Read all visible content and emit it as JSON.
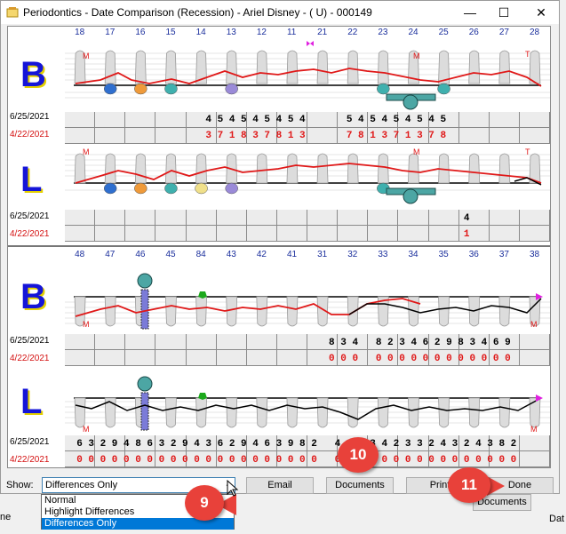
{
  "window": {
    "title": "Periodontics - Date Comparison (Recession) - Ariel Disney - ( U) - 000149",
    "minimize": "—",
    "maximize": "☐",
    "close": "✕"
  },
  "upper": {
    "tooth_numbers": [
      "18",
      "17",
      "16",
      "15",
      "14",
      "13",
      "12",
      "11",
      "21",
      "22",
      "23",
      "24",
      "25",
      "26",
      "27",
      "28"
    ],
    "buccal": {
      "letter": "B",
      "date1": "6/25/2021",
      "date2": "4/22/2021",
      "row1": "                        4 5 4 5 4 5 4 5 4       5 4 5 4 5 4 5 4 5",
      "row2": "                        3 7 1 8 3 7 8 1 3       7 8 1 3 7 1 3 7 8"
    },
    "lingual": {
      "letter": "L",
      "date1": "6/25/2021",
      "date2": "4/22/2021",
      "row1": "                                                                    4",
      "row2": "                                                                    1"
    }
  },
  "lower": {
    "tooth_numbers": [
      "48",
      "47",
      "46",
      "45",
      "84",
      "43",
      "42",
      "41",
      "31",
      "32",
      "33",
      "34",
      "35",
      "36",
      "37",
      "38"
    ],
    "buccal": {
      "letter": "B",
      "date1": "6/25/2021",
      "date2": "4/22/2021",
      "row1": "                                             8 3 4   8 2 3 4 6 2 9 8 3 4 6 9",
      "row2": "                                             0 0 0   0 0 0 0 0 0 0 0 0 0 0 0"
    },
    "lingual": {
      "letter": "L",
      "date1": "6/25/2021",
      "date2": "4/22/2021",
      "row1": "  6 3 2 9 4 8 6 3 2 9 4 3 6 2 9 4 6 3 9 8 2   4 2 8 3 4 2 3 3 2 4 3 2 4 3 8 2",
      "row2": "  0 0 0 0 0 0 0 0 0 0 0 0 0 0 0 0 0 0 0 0 0   0 0 0 0 0 0 0 0 0 0 0 0 0 0 0 0"
    }
  },
  "controls": {
    "show_label": "Show:",
    "show_value": "Differences Only",
    "options": [
      "Normal",
      "Highlight Differences",
      "Differences Only"
    ],
    "email": "Email",
    "documents": "Documents",
    "print": "Print",
    "done": "Done"
  },
  "callouts": {
    "c9": "9",
    "c10": "10",
    "c11": "11"
  },
  "background": {
    "documents": "Documents",
    "dat": "Dat",
    "ne": "ne"
  },
  "colors": {
    "red_line": "#e01818",
    "black_line": "#000000",
    "letter": "#1515d8"
  }
}
